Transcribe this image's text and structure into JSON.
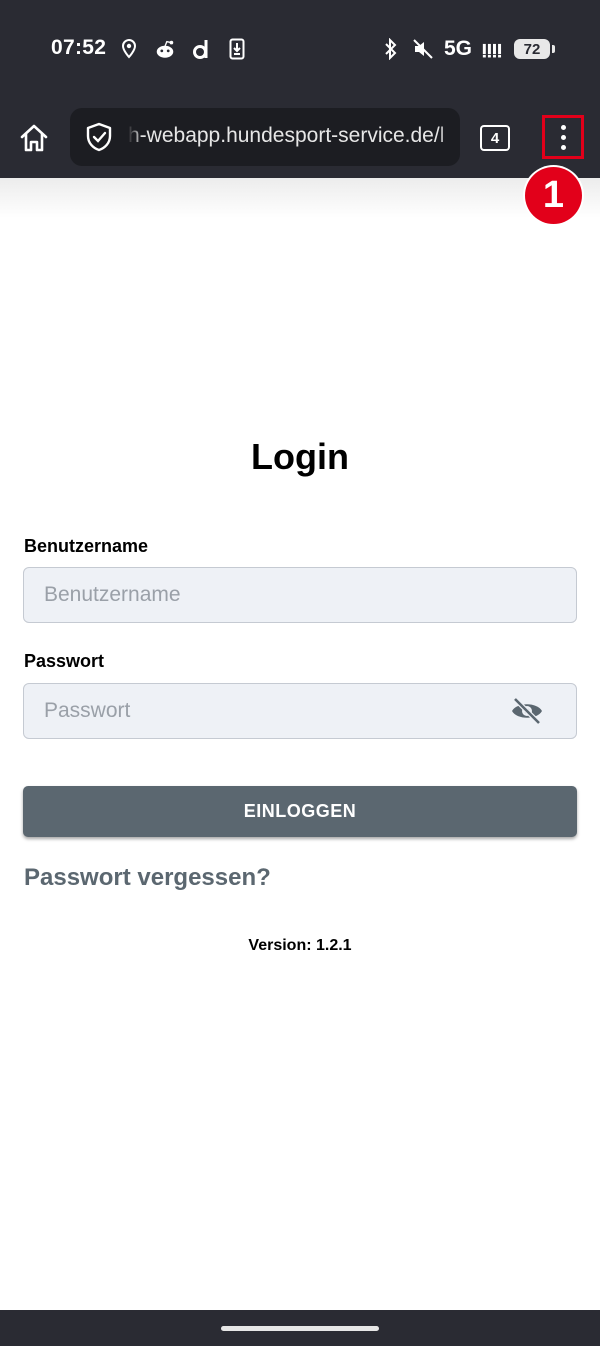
{
  "status_bar": {
    "time": "07:52",
    "left_icons": [
      "location-icon",
      "reddit-icon",
      "app-d-icon",
      "download-icon"
    ],
    "network": "5G",
    "battery_level": "72",
    "right_icons": [
      "bluetooth-icon",
      "mute-icon",
      "signal-icon",
      "battery-icon"
    ]
  },
  "browser": {
    "url": "h-webapp.hundesport-service.de/l",
    "tab_count": "4"
  },
  "annotation": {
    "badge": "1",
    "color": "#e2001a"
  },
  "login": {
    "title": "Login",
    "username_label": "Benutzername",
    "username_placeholder": "Benutzername",
    "password_label": "Passwort",
    "password_placeholder": "Passwort",
    "submit_label": "EINLOGGEN",
    "forgot_label": "Passwort vergessen?",
    "version": "Version: 1.2.1"
  },
  "colors": {
    "chrome": "#2a2b33",
    "button": "#5b6770",
    "input_bg": "#eef1f6"
  }
}
